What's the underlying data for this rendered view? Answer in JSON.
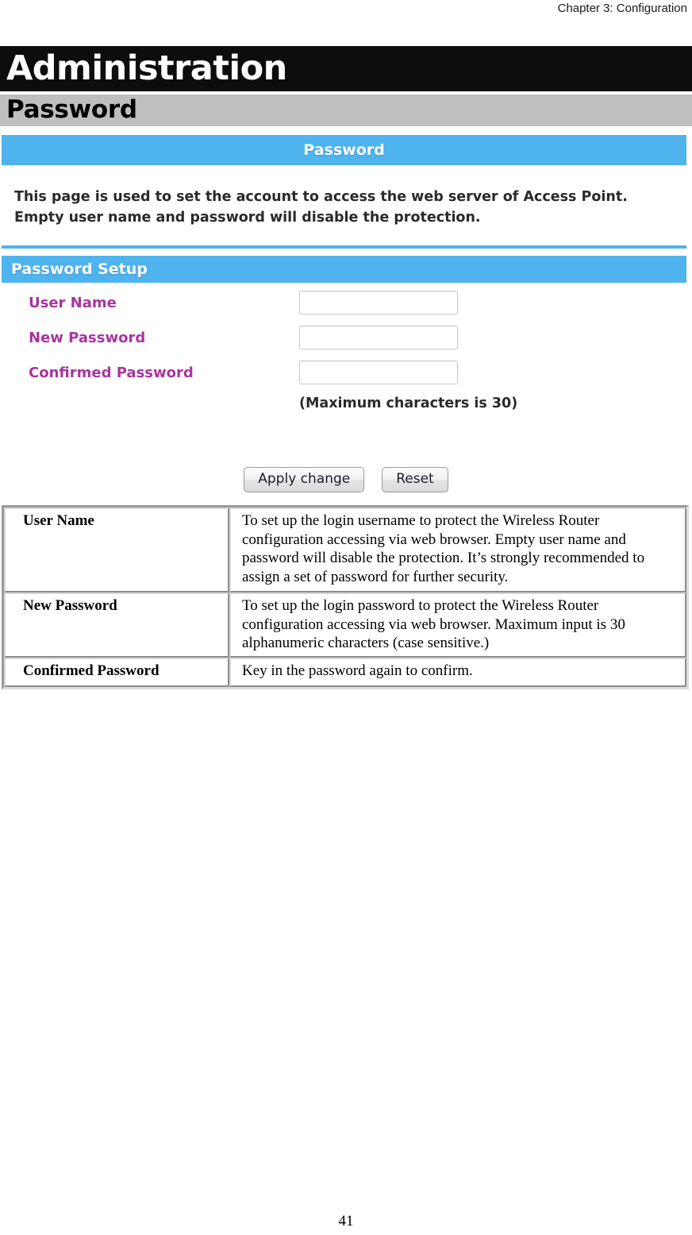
{
  "document": {
    "running_header": "Chapter 3: Configuration",
    "page_number": "41"
  },
  "section": {
    "title": "Administration",
    "subtitle": "Password"
  },
  "router_ui": {
    "page_title_bar": "Password",
    "intro_text": "This page is used to set the account to access the web server of Access Point. Empty user name and password will disable the protection.",
    "section_bar": "Password Setup",
    "form": {
      "fields": [
        {
          "label": "User Name",
          "value": "",
          "placeholder": ""
        },
        {
          "label": "New Password",
          "value": "",
          "placeholder": ""
        },
        {
          "label": "Confirmed Password",
          "value": "",
          "placeholder": ""
        }
      ],
      "hint": "(Maximum characters is 30)"
    },
    "buttons": {
      "apply": "Apply change",
      "reset": "Reset"
    },
    "colors": {
      "accent_blue": "#4fb3ee",
      "label_magenta": "#a8349f",
      "title_band_black": "#0d0d0d",
      "subtitle_band_gray": "#bfbfbf"
    }
  },
  "description_table": {
    "rows": [
      {
        "term": "User Name",
        "definition": "To set up the login username to protect the Wireless Router configuration accessing via web browser. Empty user name and password will disable the protection. It’s strongly recommended to assign a set of password for further security."
      },
      {
        "term": "New Password",
        "definition": "To set up the login password to protect the Wireless Router configuration accessing via web browser. Maximum input is 30 alphanumeric characters (case sensitive.)"
      },
      {
        "term": "Confirmed Password",
        "definition": "Key in the password again to confirm."
      }
    ]
  }
}
